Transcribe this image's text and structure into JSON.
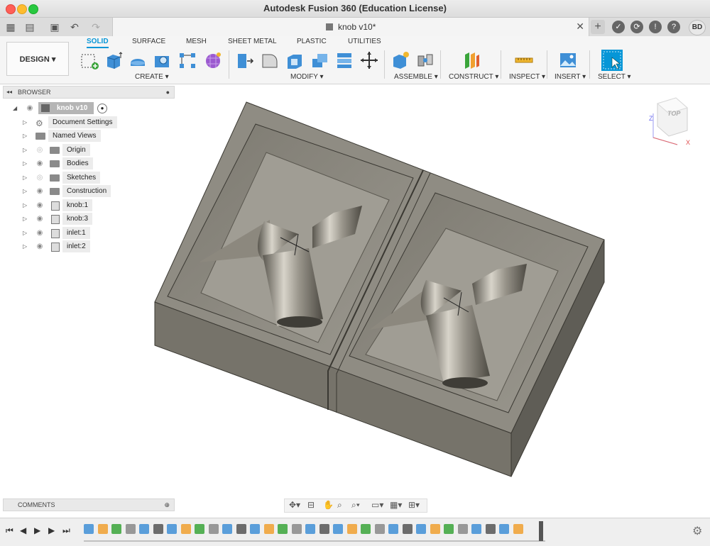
{
  "window": {
    "title": "Autodesk Fusion 360 (Education License)"
  },
  "document": {
    "tab_label": "knob v10*"
  },
  "user": {
    "initials": "BD"
  },
  "workspace_button": "DESIGN",
  "workspace_tabs": [
    {
      "label": "SOLID",
      "active": true
    },
    {
      "label": "SURFACE"
    },
    {
      "label": "MESH"
    },
    {
      "label": "SHEET METAL"
    },
    {
      "label": "PLASTIC"
    },
    {
      "label": "UTILITIES"
    }
  ],
  "tool_groups": [
    {
      "label": "CREATE"
    },
    {
      "label": "MODIFY"
    },
    {
      "label": "ASSEMBLE"
    },
    {
      "label": "CONSTRUCT"
    },
    {
      "label": "INSPECT"
    },
    {
      "label": "INSERT"
    },
    {
      "label": "SELECT"
    }
  ],
  "browser": {
    "header": "BROWSER",
    "root": "knob v10",
    "items": [
      {
        "label": "Document Settings",
        "icon": "gear-icon"
      },
      {
        "label": "Named Views",
        "icon": "folder-icon"
      },
      {
        "label": "Origin",
        "icon": "folder-icon",
        "eye": "hidden"
      },
      {
        "label": "Bodies",
        "icon": "folder-icon",
        "eye": "visible"
      },
      {
        "label": "Sketches",
        "icon": "folder-icon",
        "eye": "hidden"
      },
      {
        "label": "Construction",
        "icon": "folder-icon",
        "eye": "visible"
      },
      {
        "label": "knob:1",
        "icon": "component-icon",
        "eye": "visible"
      },
      {
        "label": "knob:3",
        "icon": "component-icon",
        "eye": "visible"
      },
      {
        "label": "inlet:1",
        "icon": "component-icon",
        "eye": "visible"
      },
      {
        "label": "inlet:2",
        "icon": "component-icon",
        "eye": "visible"
      }
    ]
  },
  "comments": {
    "header": "COMMENTS"
  },
  "viewcube": {
    "face": "TOP",
    "axes": [
      "Z",
      "X"
    ]
  },
  "colors": {
    "accent": "#0696d7",
    "model": "#8f8c83"
  }
}
